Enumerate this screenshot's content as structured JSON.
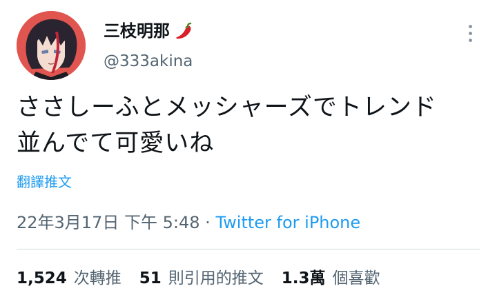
{
  "author": {
    "display_name": "三枝明那",
    "emoji_icon": "chili-pepper",
    "handle": "@333akina"
  },
  "tweet": {
    "text_lines": [
      "ささしーふとメッシャーズでトレンド",
      "並んでて可愛いね"
    ],
    "translate_label": "翻譯推文"
  },
  "meta": {
    "date": "22年3月17日",
    "time": "下午 5:48",
    "separator": "·",
    "source": "Twitter for iPhone"
  },
  "stats": [
    {
      "count": "1,524",
      "label": "次轉推"
    },
    {
      "count": "51",
      "label": "則引用的推文"
    },
    {
      "count": "1.3萬",
      "label": "個喜歡"
    }
  ],
  "colors": {
    "accent": "#1d9bf0",
    "secondary_text": "#536471",
    "avatar_bg": "#e0554f"
  }
}
